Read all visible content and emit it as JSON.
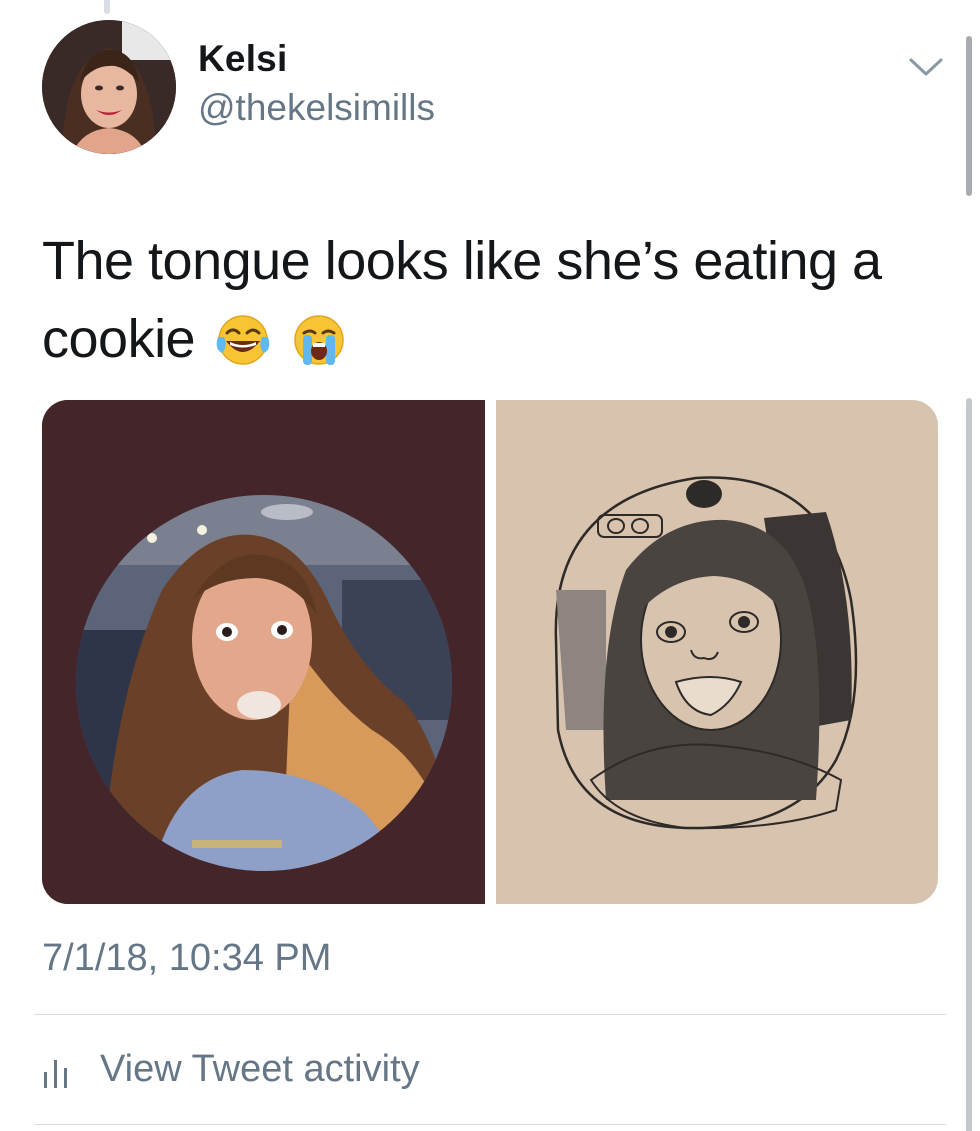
{
  "tweet": {
    "author": {
      "display_name": "Kelsi",
      "handle": "@thekelsimills"
    },
    "text": "The tongue looks like she’s eating a cookie",
    "emojis": [
      "face-with-tears-of-joy-icon",
      "loudly-crying-face-icon"
    ],
    "timestamp": "7/1/18, 10:34 PM",
    "media": [
      {
        "kind": "photo",
        "subject": "circular profile photo on dark maroon background"
      },
      {
        "kind": "photo",
        "subject": "pencil drawing of the profile photo on tan paper"
      }
    ]
  },
  "actions": {
    "activity_label": "View Tweet activity",
    "activity_icon": "bar-chart-icon",
    "more_icon": "chevron-down-icon"
  },
  "colors": {
    "text_primary": "#14171a",
    "text_secondary": "#657786",
    "divider": "#d9dee2",
    "left_media_bg": "#43252a",
    "right_media_bg": "#d8c4ae"
  }
}
